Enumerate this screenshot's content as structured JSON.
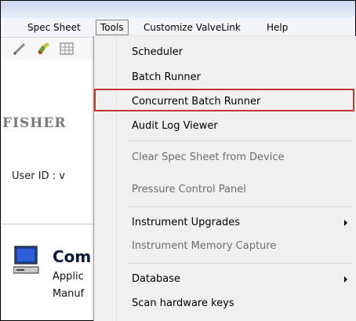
{
  "menubar": {
    "items": [
      {
        "label": "Spec Sheet"
      },
      {
        "label": "Tools",
        "active": true
      },
      {
        "label": "Customize ValveLink"
      },
      {
        "label": "Help"
      }
    ]
  },
  "background": {
    "brand_text": "FISHER",
    "user_id_text": "User ID   : v",
    "section_title": "Com",
    "line1": "Applic",
    "line2": "Manuf"
  },
  "tools_menu": {
    "items": [
      {
        "label": "Scheduler",
        "enabled": true
      },
      {
        "label": "Batch Runner",
        "enabled": true
      },
      {
        "label": "Concurrent Batch Runner",
        "enabled": true,
        "highlighted": true
      },
      {
        "label": "Audit Log Viewer",
        "enabled": true
      },
      {
        "label": "Clear Spec Sheet from Device",
        "enabled": false
      },
      {
        "label": "Pressure Control Panel",
        "enabled": false
      },
      {
        "label": "Instrument Upgrades",
        "enabled": true,
        "submenu": true
      },
      {
        "label": "Instrument Memory Capture",
        "enabled": false
      },
      {
        "label": "Database",
        "enabled": true,
        "submenu": true
      },
      {
        "label": "Scan hardware keys",
        "enabled": true
      }
    ]
  },
  "colors": {
    "highlight_border": "#c0392b",
    "menu_bg": "#f0f0f0",
    "disabled_text": "#6d6d6d"
  }
}
